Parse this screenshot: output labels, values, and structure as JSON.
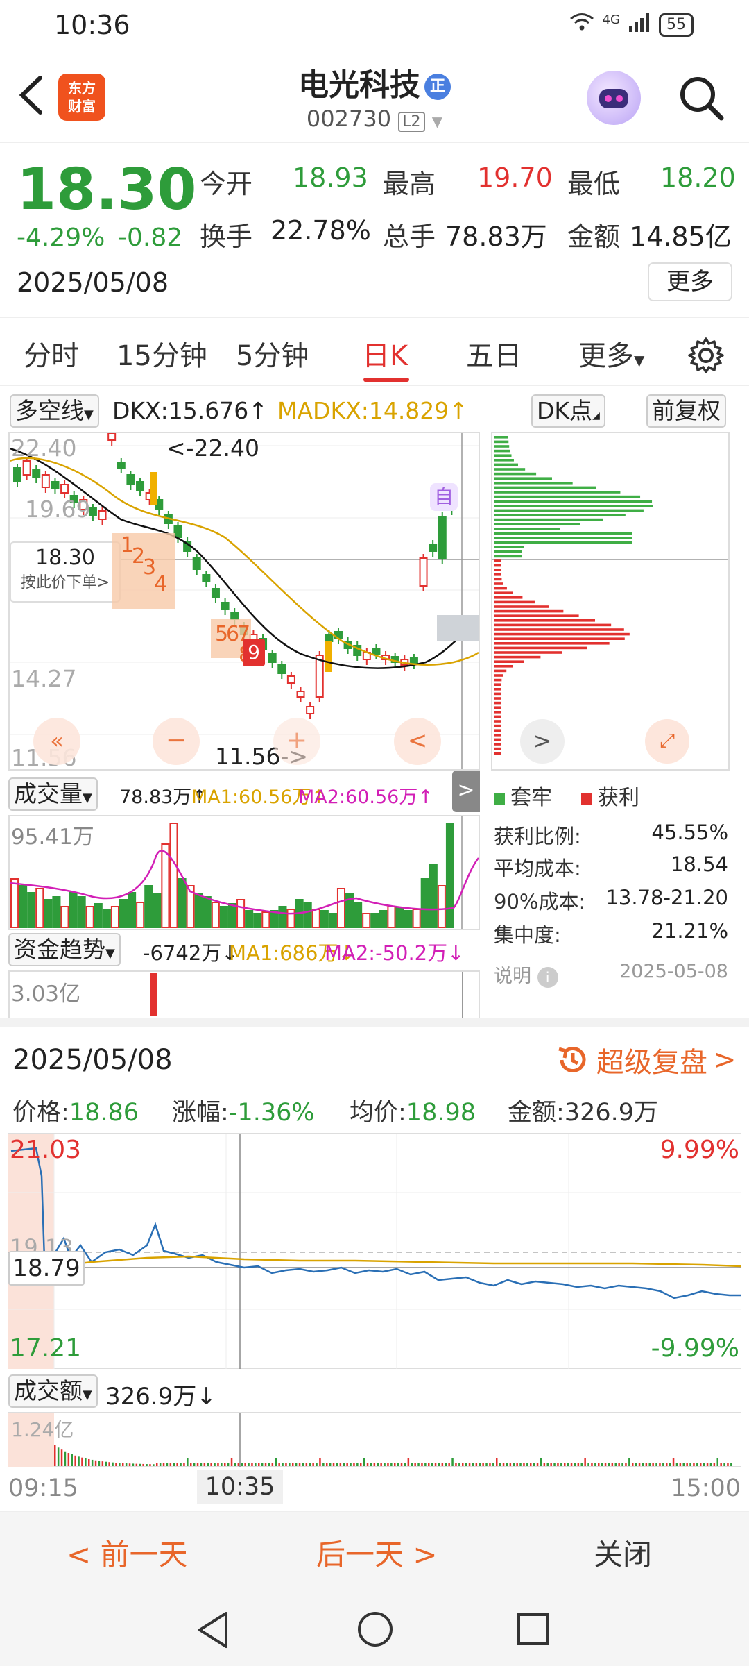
{
  "status": {
    "time": "10:36",
    "network": "4G",
    "battery": "55"
  },
  "header": {
    "logo_line1": "东方",
    "logo_line2": "财富",
    "name": "电光科技",
    "badge": "正",
    "code": "002730",
    "level": "L2"
  },
  "quote": {
    "price": "18.30",
    "change_pct": "-4.29%",
    "change_val": "-0.82",
    "date": "2025/05/08",
    "open_label": "今开",
    "open": "18.93",
    "high_label": "最高",
    "high": "19.70",
    "low_label": "最低",
    "low": "18.20",
    "turnover_label": "换手",
    "turnover": "22.78%",
    "volume_label": "总手",
    "volume": "78.83万",
    "amount_label": "金额",
    "amount": "14.85亿",
    "more": "更多"
  },
  "tabs": [
    "分时",
    "15分钟",
    "5分钟",
    "日K",
    "五日",
    "更多"
  ],
  "indicator": {
    "selector": "多空线",
    "dkx": "DKX:15.676↑",
    "madkx": "MADKX:14.829↑",
    "dk_point": "DK点",
    "adjust": "前复权"
  },
  "kline": {
    "max_label": "22.40",
    "max_arrow": "<-22.40",
    "mid_label": "14.27",
    "top_left_label": "19.69",
    "low_label": "11.56",
    "low_arrow": "11.56->",
    "price_tag": "18.30",
    "price_tag_hint": "按此价下单",
    "self_mark": "自",
    "marks": [
      "1",
      "2",
      "3",
      "4",
      "5",
      "6",
      "7",
      "8",
      "9"
    ]
  },
  "chip": {
    "legend_locked": "套牢",
    "legend_profit": "获利",
    "profit_ratio_label": "获利比例:",
    "profit_ratio": "45.55%",
    "avg_cost_label": "平均成本:",
    "avg_cost": "18.54",
    "cost90_label": "90%成本:",
    "cost90": "13.78-21.20",
    "concentration_label": "集中度:",
    "concentration": "21.21%",
    "note_label": "说明",
    "note_date": "2025-05-08"
  },
  "volume": {
    "selector": "成交量",
    "value": "78.83万↑",
    "ma1": "MA1:60.56万↑",
    "ma2": "MA2:60.56万↑",
    "max_label": "95.41万"
  },
  "capital": {
    "selector": "资金趋势",
    "value": "-6742万↓",
    "ma1": "MA1:686万↓",
    "ma2": "MA2:-50.2万↓",
    "max_label": "3.03亿"
  },
  "replay": {
    "date": "2025/05/08",
    "super_replay": "超级复盘",
    "price_label": "价格:",
    "price": "18.86",
    "chg_label": "涨幅:",
    "chg": "-1.36%",
    "avg_label": "均价:",
    "avg": "18.98",
    "amount_label": "金额:",
    "amount": "326.9万",
    "upper": "21.03",
    "upper_pct": "9.99%",
    "ref_label": "19.13",
    "cursor_price": "18.79",
    "lower": "17.21",
    "lower_pct": "-9.99%",
    "amount_selector": "成交额",
    "amount_value": "326.9万↓",
    "amount_max": "1.24亿",
    "time_start": "09:15",
    "time_cursor": "10:35",
    "time_end": "15:00"
  },
  "bottom": {
    "prev": "前一天",
    "next": "后一天",
    "close": "关闭"
  }
}
